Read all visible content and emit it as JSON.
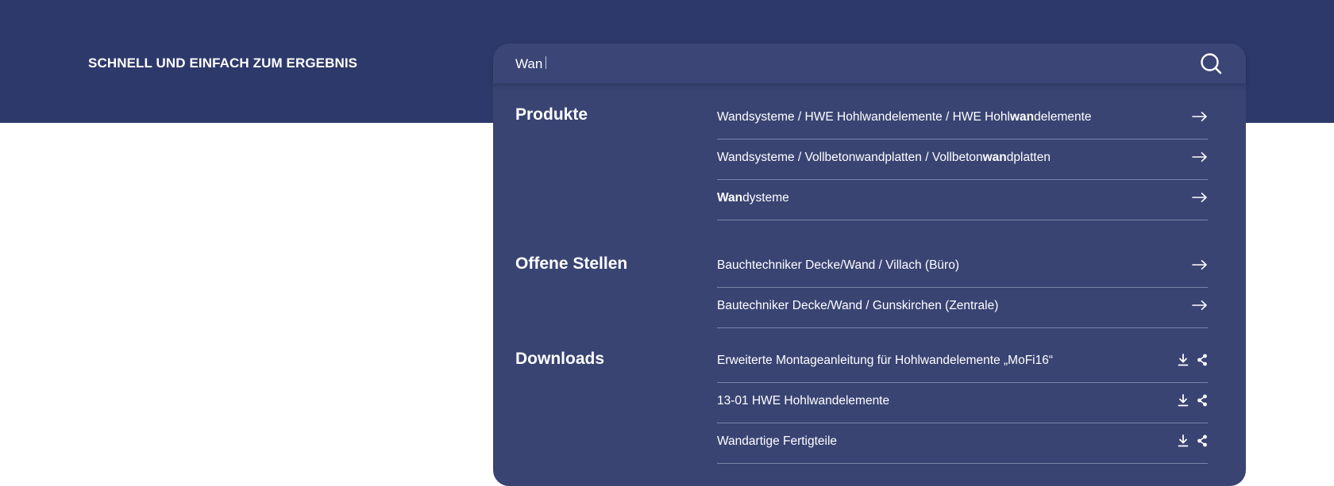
{
  "header": {
    "tagline": "SCHNELL UND EINFACH ZUM ERGEBNIS"
  },
  "search": {
    "value": "Wan",
    "placeholder": ""
  },
  "sections": {
    "products": {
      "title": "Produkte",
      "items": [
        {
          "pre": "Wandsysteme / HWE Hohlwandelemente / HWE Hohl",
          "hl": "wan",
          "post": "delemente"
        },
        {
          "pre": "Wandsysteme / Vollbetonwandplatten / Vollbeton",
          "hl": "wan",
          "post": "dplatten"
        },
        {
          "pre": "",
          "hl": "Wan",
          "post": "dysteme"
        }
      ]
    },
    "jobs": {
      "title": "Offene Stellen",
      "items": [
        "Bauchtechniker Decke/Wand / Villach (Büro)",
        "Bautechniker Decke/Wand / Gunskirchen (Zentrale)"
      ]
    },
    "downloads": {
      "title": "Downloads",
      "items": [
        "Erweiterte Montageanleitung für Hohlwandelemente „MoFi16“",
        "13-01 HWE Hohlwandelemente",
        "Wandartige Fertigteile"
      ]
    }
  },
  "icons": {
    "search": "search-icon",
    "result_link": "arrow-right-icon",
    "download": "download-icon",
    "share": "share-icon"
  },
  "colors": {
    "header_band": "#2e396b",
    "panel": "#394473",
    "text": "#ffffff",
    "divider": "#7b84a9"
  }
}
